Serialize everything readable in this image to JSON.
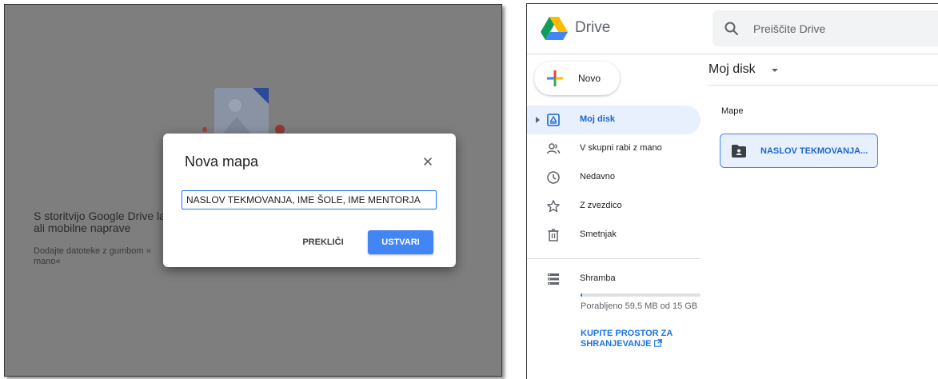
{
  "left_panel": {
    "empty_state": {
      "title_line1": "S storitvijo Google Drive la",
      "title_line2": "ali mobilne naprave",
      "sub_line1": "Dodajte datoteke z gumbom »",
      "sub_line2": "mano«"
    },
    "dialog": {
      "title": "Nova mapa",
      "input_value": "NASLOV TEKMOVANJA, IME ŠOLE, IME MENTORJA",
      "cancel_label": "PREKLIČI",
      "create_label": "USTVARI"
    }
  },
  "right_panel": {
    "brand": "Drive",
    "search_placeholder": "Preiščite Drive",
    "new_button": "Novo",
    "nav": [
      {
        "label": "Moj disk",
        "icon": "drive-icon"
      },
      {
        "label": "V skupni rabi z mano",
        "icon": "people-icon"
      },
      {
        "label": "Nedavno",
        "icon": "clock-icon"
      },
      {
        "label": "Z zvezdico",
        "icon": "star-icon"
      },
      {
        "label": "Smetnjak",
        "icon": "trash-icon"
      }
    ],
    "storage": {
      "label": "Shramba",
      "usage_text": "Porabljeno 59,5 MB od 15 GB",
      "buy_link": "KUPITE PROSTOR ZA SHRANJEVANJE"
    },
    "main": {
      "title": "Moj disk",
      "section_label": "Mape",
      "folders": [
        {
          "name": "NASLOV TEKMOVANJA..."
        }
      ]
    },
    "colors": {
      "accent": "#1a73e8",
      "active_bg": "#e8f0fe",
      "primary_button": "#4285f4"
    }
  }
}
